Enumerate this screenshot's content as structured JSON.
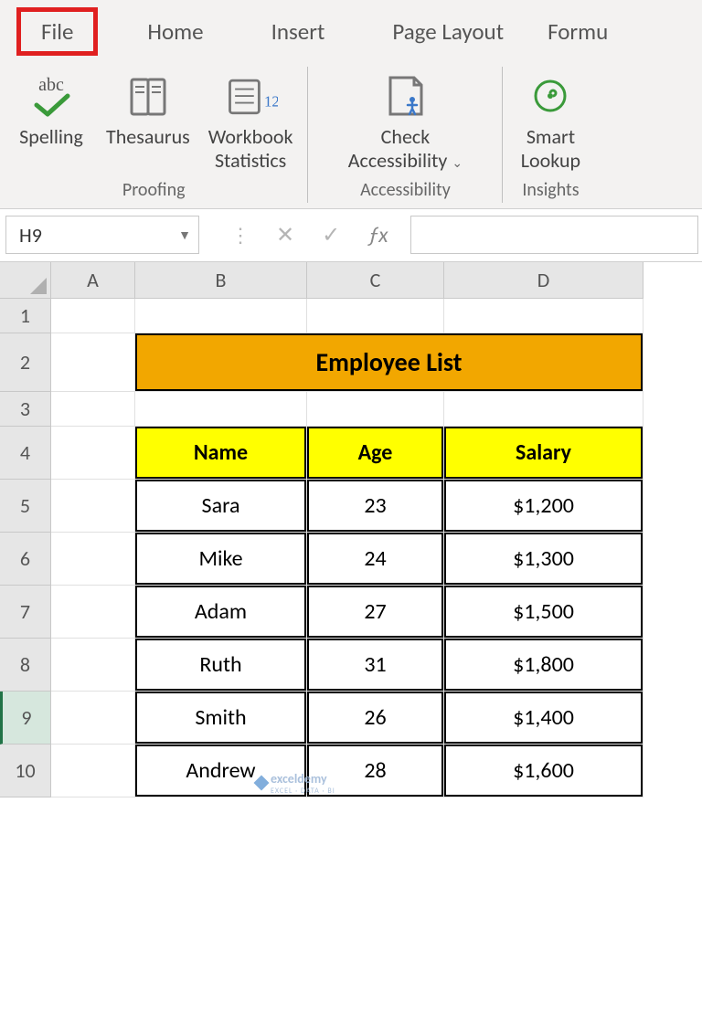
{
  "tabs": {
    "file": "File",
    "home": "Home",
    "insert": "Insert",
    "page_layout": "Page Layout",
    "formulas": "Formu"
  },
  "ribbon": {
    "spelling": "Spelling",
    "thesaurus": "Thesaurus",
    "workbook_stats_l1": "Workbook",
    "workbook_stats_l2": "Statistics",
    "check_access_l1": "Check",
    "check_access_l2": "Accessibility",
    "smart_l1": "Smart",
    "smart_l2": "Lookup",
    "group_proofing": "Proofing",
    "group_accessibility": "Accessibility",
    "group_insights": "Insights"
  },
  "namebox": {
    "value": "H9"
  },
  "columns": [
    "A",
    "B",
    "C",
    "D"
  ],
  "rows": [
    "1",
    "2",
    "3",
    "4",
    "5",
    "6",
    "7",
    "8",
    "9",
    "10"
  ],
  "sheet": {
    "title": "Employee List",
    "headers": {
      "name": "Name",
      "age": "Age",
      "salary": "Salary"
    },
    "data": [
      {
        "name": "Sara",
        "age": "23",
        "salary": "$1,200"
      },
      {
        "name": "Mike",
        "age": "24",
        "salary": "$1,300"
      },
      {
        "name": "Adam",
        "age": "27",
        "salary": "$1,500"
      },
      {
        "name": "Ruth",
        "age": "31",
        "salary": "$1,800"
      },
      {
        "name": "Smith",
        "age": "26",
        "salary": "$1,400"
      },
      {
        "name": "Andrew",
        "age": "28",
        "salary": "$1,600"
      }
    ]
  },
  "watermark": {
    "brand": "exceldemy",
    "tagline": "EXCEL · DATA · BI"
  }
}
